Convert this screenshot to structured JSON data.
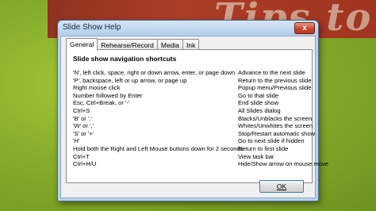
{
  "window": {
    "title": "Slide Show Help",
    "close_label": "x"
  },
  "tabs": [
    {
      "label": "General",
      "active": true
    },
    {
      "label": "Rehearse/Record",
      "active": false
    },
    {
      "label": "Media",
      "active": false
    },
    {
      "label": "Ink",
      "active": false
    }
  ],
  "panel": {
    "heading": "Slide show navigation shortcuts",
    "rows": [
      {
        "keys": "'N', left click, space, right or down arrow, enter, or page down",
        "action": "Advance to the next slide"
      },
      {
        "keys": "'P', backspace, left or up arrow, or page up",
        "action": "Return to the previous slide"
      },
      {
        "keys": "Right mouse click",
        "action": "Popup menu/Previous slide"
      },
      {
        "keys": "Number followed by Enter",
        "action": "Go to that slide"
      },
      {
        "keys": "Esc, Ctrl+Break, or '-'",
        "action": "End slide show"
      },
      {
        "keys": "Ctrl+S",
        "action": "All Slides dialog"
      },
      {
        "keys": "'B' or '.'",
        "action": "Blacks/Unblacks the screen"
      },
      {
        "keys": "'W' or ','",
        "action": "Whites/Unwhites the screen"
      },
      {
        "keys": "'S' or '+'",
        "action": "Stop/Restart automatic show"
      },
      {
        "keys": "'H'",
        "action": "Go to next slide if hidden"
      },
      {
        "keys": "Hold both the Right and Left Mouse buttons down for 2 seconds",
        "action": "Return to first slide"
      },
      {
        "keys": "Ctrl+T",
        "action": "View task bar"
      },
      {
        "keys": "Ctrl+H/U",
        "action": "Hide/Show arrow on mouse move"
      }
    ]
  },
  "ok_button": {
    "label": "OK"
  },
  "colors": {
    "dialog_frame": "#b9d3ee",
    "close_button": "#c8452e",
    "background": "#86ad2b",
    "banner": "#b32a27"
  }
}
